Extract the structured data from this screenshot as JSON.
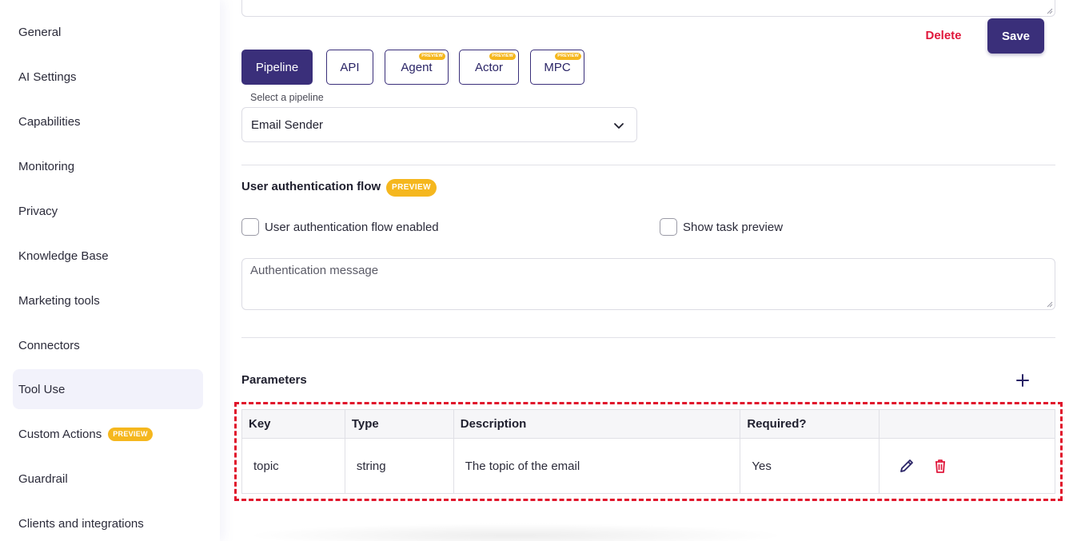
{
  "sidebar": {
    "items": [
      {
        "label": "General"
      },
      {
        "label": "AI Settings"
      },
      {
        "label": "Capabilities"
      },
      {
        "label": "Monitoring"
      },
      {
        "label": "Privacy"
      },
      {
        "label": "Knowledge Base"
      },
      {
        "label": "Marketing tools"
      },
      {
        "label": "Connectors"
      },
      {
        "label": "Tool Use",
        "active": true
      },
      {
        "label": "Custom Actions",
        "badge": "PREVIEW"
      },
      {
        "label": "Guardrail"
      },
      {
        "label": "Clients and integrations"
      }
    ]
  },
  "actions": {
    "delete_label": "Delete",
    "save_label": "Save"
  },
  "tool_tabs": [
    {
      "label": "Pipeline",
      "active": true
    },
    {
      "label": "API"
    },
    {
      "label": "Agent",
      "badge": "PREVIEW"
    },
    {
      "label": "Actor",
      "badge": "PREVIEW"
    },
    {
      "label": "MPC",
      "badge": "PREVIEW"
    }
  ],
  "pipeline": {
    "select_label": "Select a pipeline",
    "selected_value": "Email Sender"
  },
  "auth_flow": {
    "title": "User authentication flow",
    "badge": "PREVIEW",
    "enabled_label": "User authentication flow enabled",
    "show_task_preview_label": "Show task preview",
    "message_placeholder": "Authentication message"
  },
  "parameters": {
    "title": "Parameters",
    "columns": [
      "Key",
      "Type",
      "Description",
      "Required?",
      ""
    ],
    "rows": [
      {
        "key": "topic",
        "type": "string",
        "description": "The topic of the email",
        "required": "Yes"
      }
    ]
  },
  "colors": {
    "primary": "#3a2f7a",
    "badge": "#f5b71e",
    "danger": "#e0173b"
  },
  "icons": [
    "chevron-down-icon",
    "plus-icon",
    "pencil-icon",
    "trash-icon"
  ]
}
